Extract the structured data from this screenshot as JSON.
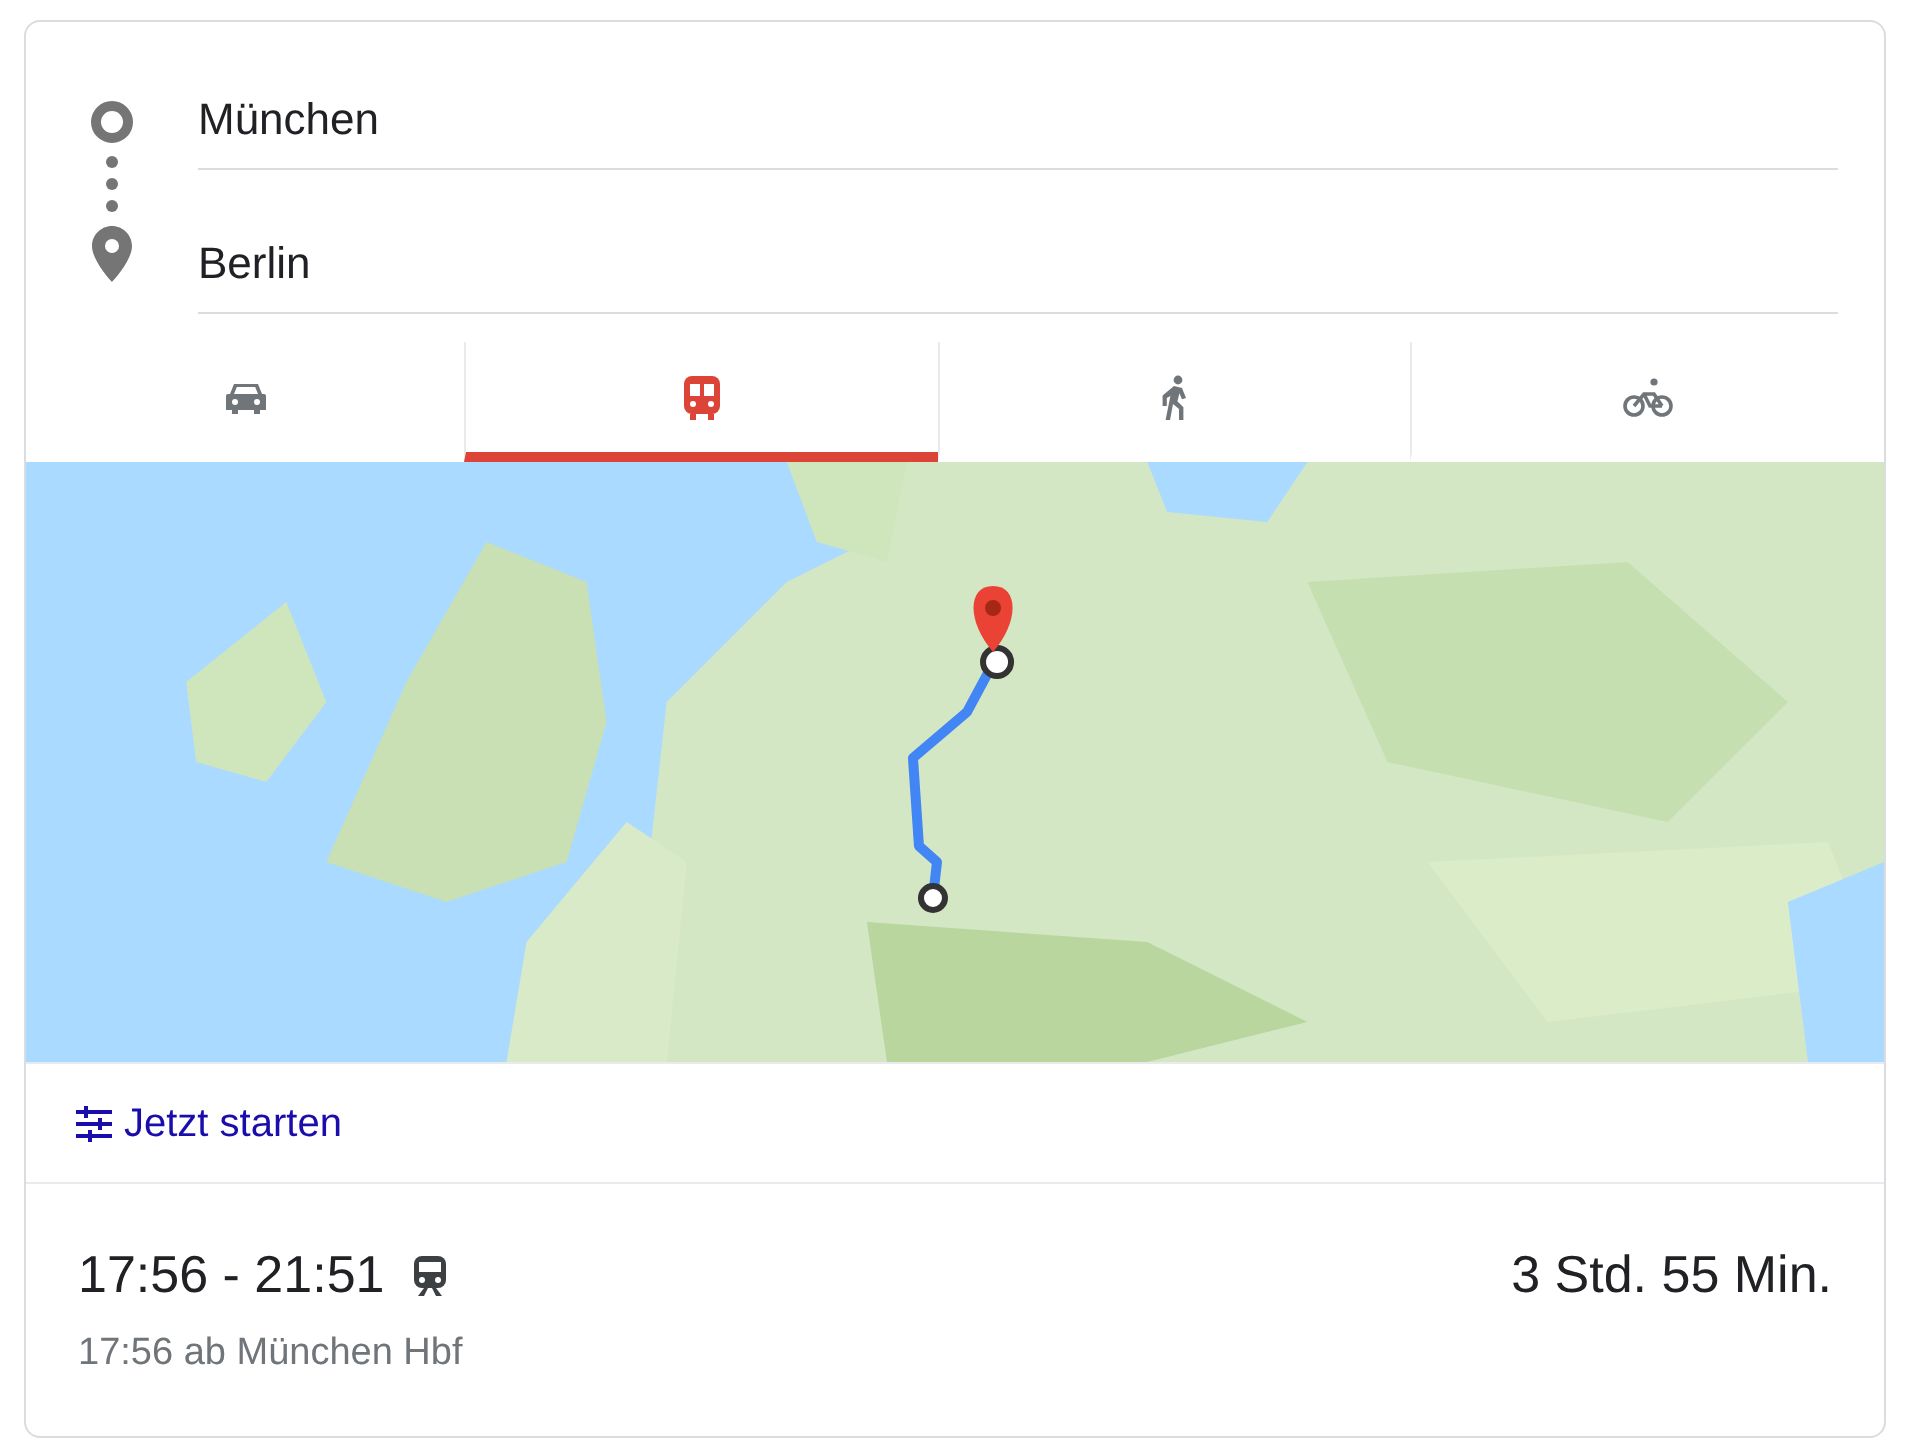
{
  "route": {
    "origin": "München",
    "destination": "Berlin"
  },
  "modes": [
    {
      "kind": "car",
      "selected": false
    },
    {
      "kind": "transit",
      "selected": true
    },
    {
      "kind": "walk",
      "selected": false
    },
    {
      "kind": "bike",
      "selected": false
    }
  ],
  "options_link": "Jetzt starten",
  "result": {
    "times": "17:56 - 21:51",
    "duration": "3 Std. 55 Min.",
    "departure": "17:56 ab München Hbf"
  }
}
